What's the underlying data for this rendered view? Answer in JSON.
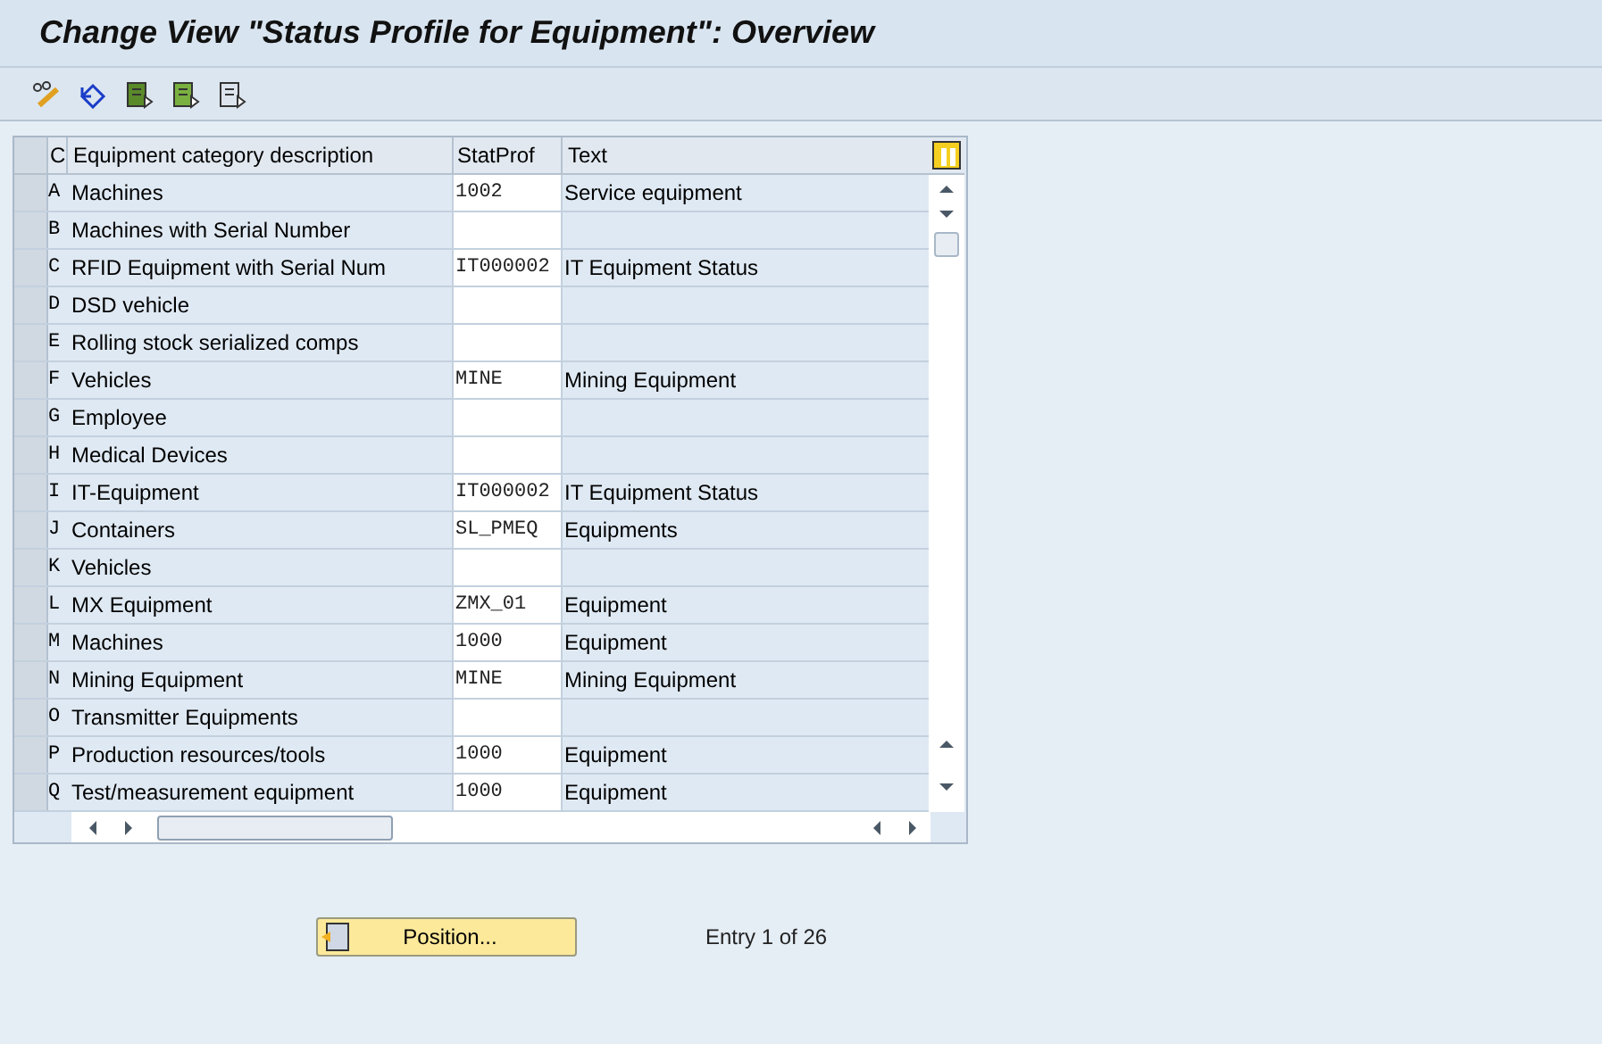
{
  "window": {
    "title": "Change View \"Status Profile for Equipment\": Overview"
  },
  "table": {
    "columns": [
      "C",
      "Equipment category description",
      "StatProf",
      "Text"
    ],
    "rows": [
      {
        "key": "A",
        "description": "Machines",
        "statprof": "1002",
        "text": "Service equipment"
      },
      {
        "key": "B",
        "description": "Machines with Serial Number"
      },
      {
        "key": "C",
        "description": "RFID Equipment with Serial Num",
        "statprof": "IT000002",
        "text": "IT Equipment Status"
      },
      {
        "key": "D",
        "description": "DSD vehicle"
      },
      {
        "key": "E",
        "description": "Rolling stock serialized comps"
      },
      {
        "key": "F",
        "description": "Vehicles",
        "statprof": "MINE",
        "text": "Mining Equipment"
      },
      {
        "key": "G",
        "description": "Employee"
      },
      {
        "key": "H",
        "description": "Medical Devices"
      },
      {
        "key": "I",
        "description": "IT-Equipment",
        "statprof": "IT000002",
        "text": "IT Equipment Status"
      },
      {
        "key": "J",
        "description": "Containers",
        "statprof": "SL_PMEQ",
        "text": "Equipments"
      },
      {
        "key": "K",
        "description": "Vehicles"
      },
      {
        "key": "L",
        "description": "MX Equipment",
        "statprof": "ZMX_01",
        "text": "Equipment"
      },
      {
        "key": "M",
        "description": "Machines",
        "statprof": "1000",
        "text": "Equipment"
      },
      {
        "key": "N",
        "description": "Mining Equipment",
        "statprof": "MINE",
        "text": "Mining Equipment"
      },
      {
        "key": "O",
        "description": "Transmitter Equipments"
      },
      {
        "key": "P",
        "description": "Production resources/tools",
        "statprof": "1000",
        "text": "Equipment"
      },
      {
        "key": "Q",
        "description": "Test/measurement equipment",
        "statprof": "1000",
        "text": "Equipment"
      }
    ]
  },
  "position_button": {
    "label": "Position..."
  },
  "entry_info": "Entry 1 of 26"
}
